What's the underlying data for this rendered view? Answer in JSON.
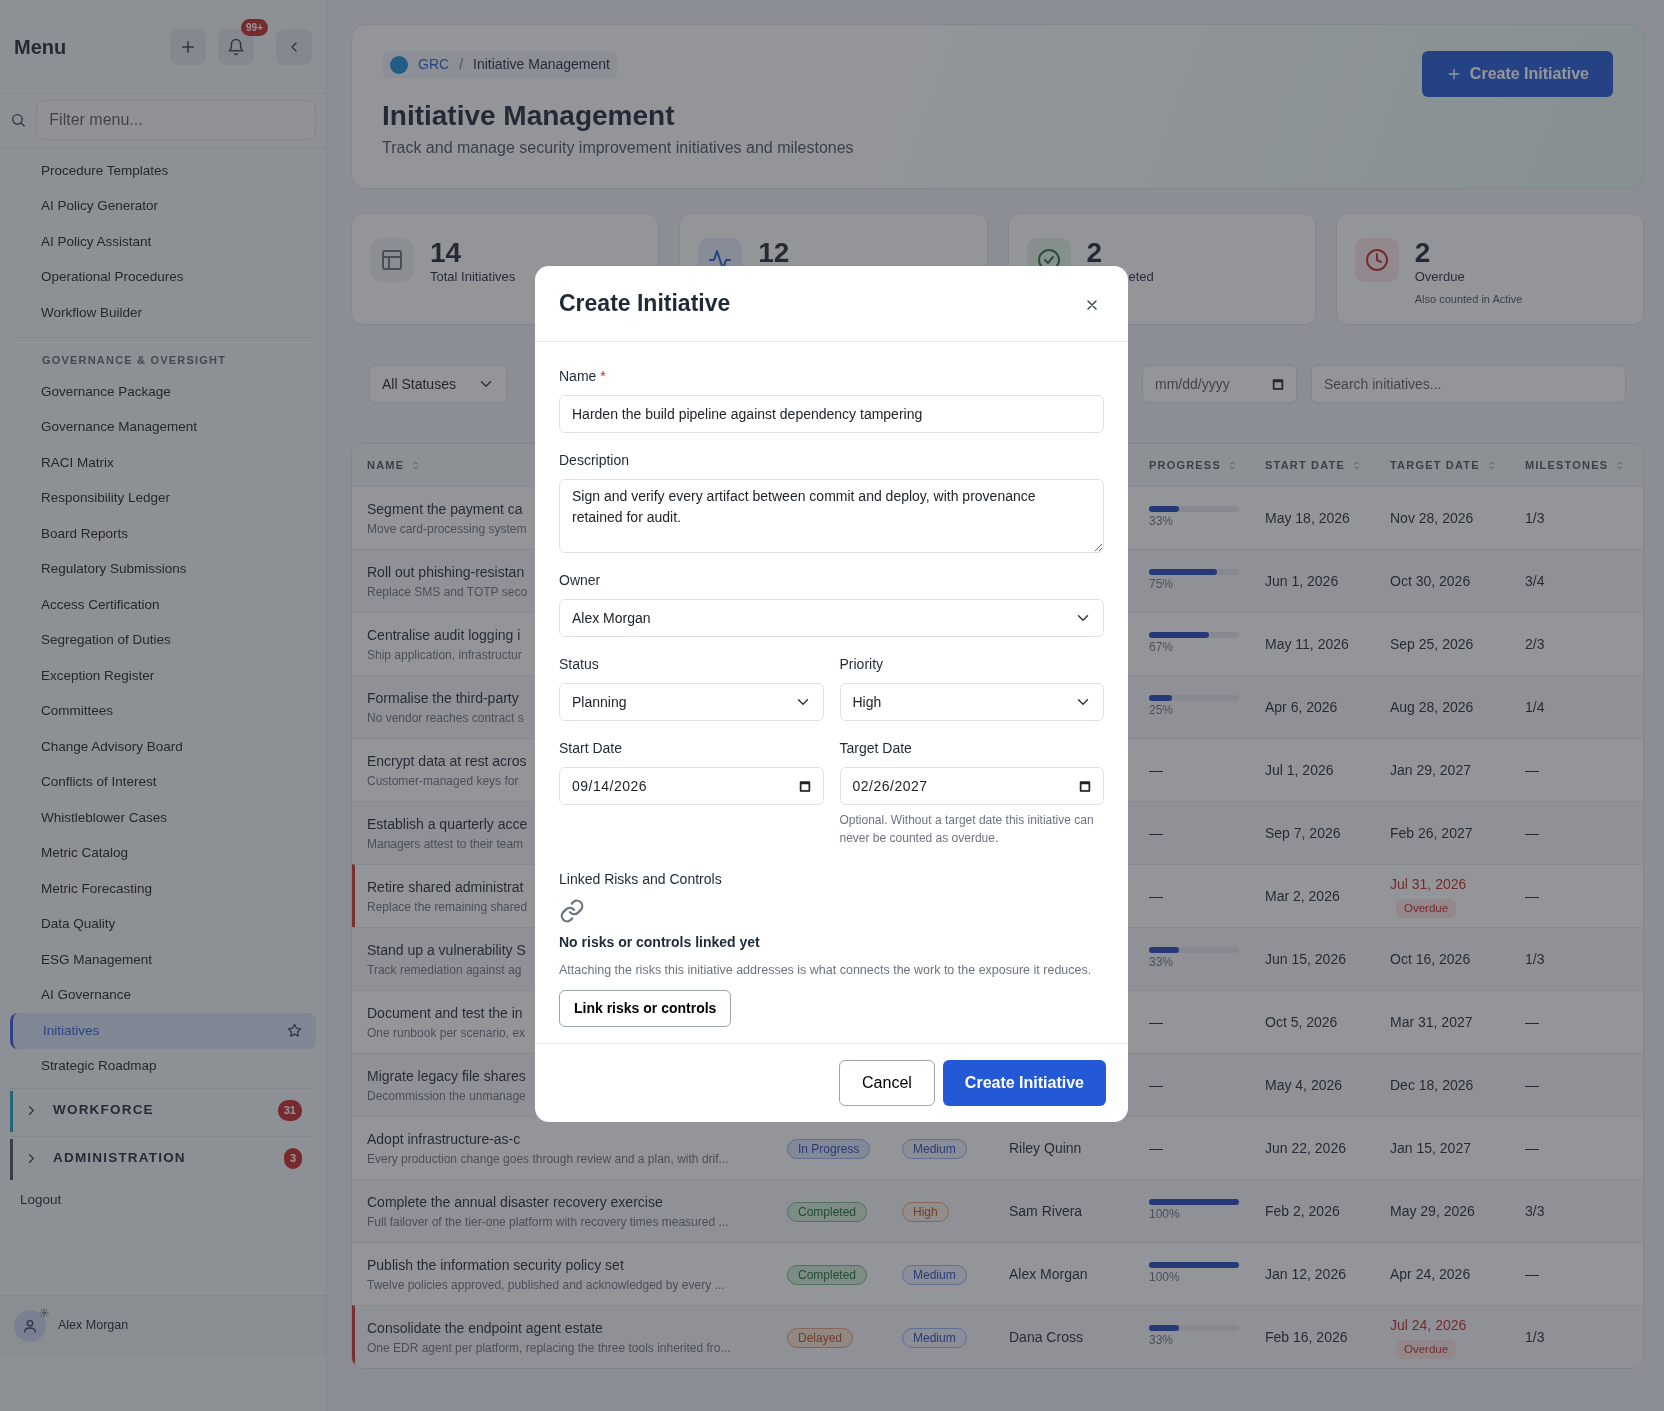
{
  "sidebar": {
    "title": "Menu",
    "notification_count": "99+",
    "filter_placeholder": "Filter menu...",
    "items": [
      {
        "label": "Procedure Templates",
        "selected": false
      },
      {
        "label": "AI Policy Generator",
        "selected": false
      },
      {
        "label": "AI Policy Assistant",
        "selected": false
      },
      {
        "label": "Operational Procedures",
        "selected": false
      },
      {
        "label": "Workflow Builder",
        "selected": false
      }
    ],
    "sections": [
      {
        "heading": "GOVERNANCE & OVERSIGHT",
        "items": [
          {
            "label": "Governance Package",
            "selected": false
          },
          {
            "label": "Governance Management",
            "selected": false
          },
          {
            "label": "RACI Matrix",
            "selected": false
          },
          {
            "label": "Responsibility Ledger",
            "selected": false
          },
          {
            "label": "Board Reports",
            "selected": false
          },
          {
            "label": "Regulatory Submissions",
            "selected": false
          },
          {
            "label": "Access Certification",
            "selected": false
          },
          {
            "label": "Segregation of Duties",
            "selected": false
          },
          {
            "label": "Exception Register",
            "selected": false
          },
          {
            "label": "Committees",
            "selected": false
          },
          {
            "label": "Change Advisory Board",
            "selected": false
          },
          {
            "label": "Conflicts of Interest",
            "selected": false
          },
          {
            "label": "Whistleblower Cases",
            "selected": false
          },
          {
            "label": "Metric Catalog",
            "selected": false
          },
          {
            "label": "Metric Forecasting",
            "selected": false
          },
          {
            "label": "Data Quality",
            "selected": false
          },
          {
            "label": "ESG Management",
            "selected": false
          },
          {
            "label": "AI Governance",
            "selected": false
          },
          {
            "label": "Initiatives",
            "selected": true
          },
          {
            "label": "Strategic Roadmap",
            "selected": false
          }
        ]
      }
    ],
    "groups": [
      {
        "label": "WORKFORCE",
        "count": "31",
        "color": "#1f6776",
        "expanded": false
      },
      {
        "label": "ADMINISTRATION",
        "count": "3",
        "color": "#383e46",
        "expanded": false
      }
    ],
    "logout": "Logout",
    "user": "Alex Morgan"
  },
  "header": {
    "breadcrumb": [
      "GRC",
      "Initiative Management"
    ],
    "breadcrumb_separator": "/",
    "title": "Initiative Management",
    "subtitle": "Track and manage security improvement initiatives and milestones",
    "button": "Create Initiative"
  },
  "stats": [
    {
      "kind": "total",
      "value": "14",
      "label": "Total Initiatives"
    },
    {
      "kind": "active",
      "value": "12"
    },
    {
      "kind": "completed",
      "value": "2",
      "label": "eted"
    },
    {
      "kind": "overdue",
      "value": "2",
      "label": "Overdue",
      "note": "Also counted in Active"
    }
  ],
  "filters": [
    {
      "kind": "select",
      "value": "All Statuses"
    },
    {
      "kind": "date",
      "placeholder": "mm/dd/yyyy"
    },
    {
      "kind": "search",
      "placeholder": "Search initiatives..."
    }
  ],
  "table": {
    "columns": {
      "name": "NAME",
      "progress": "PROGRESS",
      "start_date": "START DATE",
      "target_date": "TARGET DATE",
      "milestones": "MILESTONES"
    },
    "rows": [
      {
        "name": "Segment the payment ca",
        "description": "Move card-processing system",
        "progress": "33%",
        "level": 0.33,
        "start_date": "May 18, 2026",
        "target_date": "Nov 28, 2026",
        "overdue": false,
        "milestones": "1/3"
      },
      {
        "name": "Roll out phishing-resistan",
        "description": "Replace SMS and TOTP seco",
        "progress": "75%",
        "level": 0.75,
        "start_date": "Jun 1, 2026",
        "target_date": "Oct 30, 2026",
        "overdue": false,
        "milestones": "3/4"
      },
      {
        "name": "Centralise audit logging i",
        "description": "Ship application, infrastructur",
        "progress": "67%",
        "level": 0.67,
        "start_date": "May 11, 2026",
        "target_date": "Sep 25, 2026",
        "overdue": false,
        "milestones": "2/3"
      },
      {
        "name": "Formalise the third-party",
        "description": "No vendor reaches contract s",
        "progress": "25%",
        "level": 0.25,
        "start_date": "Apr 6, 2026",
        "target_date": "Aug 28, 2026",
        "overdue": false,
        "milestones": "1/4"
      },
      {
        "name": "Encrypt data at rest acros",
        "description": "Customer-managed keys for",
        "progress": "—",
        "start_date": "Jul 1, 2026",
        "target_date": "Jan 29, 2027",
        "overdue": false,
        "milestones": "—"
      },
      {
        "name": "Establish a quarterly acce",
        "description": "Managers attest to their team",
        "progress": "—",
        "start_date": "Sep 7, 2026",
        "target_date": "Feb 26, 2027",
        "overdue": false,
        "milestones": "—"
      },
      {
        "name": "Retire shared administrat",
        "description": "Replace the remaining shared",
        "progress": "—",
        "start_date": "Mar 2, 2026",
        "target_date": "Jul 31, 2026",
        "overdue": true,
        "overdue_label": "Overdue",
        "milestones": "—"
      },
      {
        "name": "Stand up a vulnerability S",
        "description": "Track remediation against ag",
        "progress": "33%",
        "level": 0.33,
        "start_date": "Jun 15, 2026",
        "target_date": "Oct 16, 2026",
        "overdue": false,
        "milestones": "1/3"
      },
      {
        "name": "Document and test the in",
        "description": "One runbook per scenario, ex",
        "progress": "—",
        "start_date": "Oct 5, 2026",
        "target_date": "Mar 31, 2027",
        "overdue": false,
        "milestones": "—"
      },
      {
        "name": "Migrate legacy file shares",
        "description": "Decommission the unmanage",
        "progress": "—",
        "start_date": "May 4, 2026",
        "target_date": "Dec 18, 2026",
        "overdue": false,
        "milestones": "—"
      },
      {
        "name": "Adopt infrastructure-as-c",
        "description": "Every production change goes through review and a plan, with drif...",
        "status": {
          "label": "In Progress",
          "kind": "progress"
        },
        "priority": {
          "label": "Medium",
          "kind": "medium"
        },
        "owner": "Riley Quinn",
        "progress": "—",
        "start_date": "Jun 22, 2026",
        "target_date": "Jan 15, 2027",
        "overdue": false,
        "milestones": "—"
      },
      {
        "name": "Complete the annual disaster recovery exercise",
        "description": "Full failover of the tier-one platform with recovery times measured ...",
        "status": {
          "label": "Completed",
          "kind": "completed"
        },
        "priority": {
          "label": "High",
          "kind": "high"
        },
        "owner": "Sam Rivera",
        "progress": "100%",
        "level": 1,
        "start_date": "Feb 2, 2026",
        "target_date": "May 29, 2026",
        "overdue": false,
        "milestones": "3/3"
      },
      {
        "name": "Publish the information security policy set",
        "description": "Twelve policies approved, published and acknowledged by every ...",
        "status": {
          "label": "Completed",
          "kind": "completed"
        },
        "priority": {
          "label": "Medium",
          "kind": "medium"
        },
        "owner": "Alex Morgan",
        "progress": "100%",
        "level": 1,
        "start_date": "Jan 12, 2026",
        "target_date": "Apr 24, 2026",
        "overdue": false,
        "milestones": "—"
      },
      {
        "name": "Consolidate the endpoint agent estate",
        "description": "One EDR agent per platform, replacing the three tools inherited fro...",
        "status": {
          "label": "Delayed",
          "kind": "delayed"
        },
        "priority": {
          "label": "Medium",
          "kind": "medium"
        },
        "owner": "Dana Cross",
        "progress": "33%",
        "level": 0.33,
        "start_date": "Feb 16, 2026",
        "target_date": "Jul 24, 2026",
        "overdue": true,
        "overdue_label": "Overdue",
        "milestones": "1/3"
      }
    ]
  },
  "modal": {
    "title": "Create Initiative",
    "name": {
      "label": "Name",
      "required_mark": "*",
      "value": "Harden the build pipeline against dependency tampering"
    },
    "description": {
      "label": "Description",
      "value": "Sign and verify every artifact between commit and deploy, with provenance retained for audit."
    },
    "owner": {
      "label": "Owner",
      "value": "Alex Morgan"
    },
    "status": {
      "label": "Status",
      "value": "Planning"
    },
    "priority": {
      "label": "Priority",
      "value": "High"
    },
    "start_date": {
      "label": "Start Date",
      "value": "09/14/2026"
    },
    "target_date": {
      "label": "Target Date",
      "value": "02/26/2027",
      "help": "Optional. Without a target date this initiative can never be counted as overdue."
    },
    "linked": {
      "label": "Linked Risks and Controls",
      "empty_title": "No risks or controls linked yet",
      "empty_text": "Attaching the risks this initiative addresses is what connects the work to the exposure it reduces.",
      "button": "Link risks or controls"
    },
    "buttons": [
      {
        "label": "Cancel",
        "kind": "secondary"
      },
      {
        "label": "Create Initiative",
        "kind": "primary"
      }
    ]
  }
}
